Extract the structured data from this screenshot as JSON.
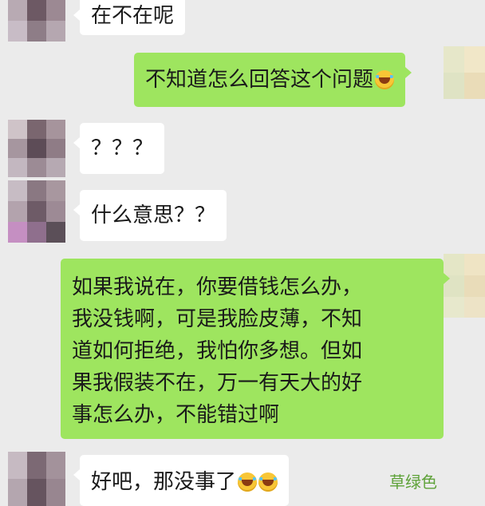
{
  "messages": [
    {
      "side": "left",
      "lines": [
        "在不在呢"
      ]
    },
    {
      "side": "right",
      "lines": [
        "不知道怎么回答这个问题"
      ],
      "emoji": [
        "face-with-tears-of-joy-icon"
      ]
    },
    {
      "side": "left",
      "lines": [
        "？？？"
      ]
    },
    {
      "side": "left",
      "lines": [
        "什么意思？？"
      ]
    },
    {
      "side": "right",
      "lines": [
        "如果我说在，你要借钱怎么办，",
        "我没钱啊，可是我脸皮薄，不知",
        "道如何拒绝，我怕你多想。但如",
        "果我假装不在，万一有天大的好",
        "事怎么办，不能错过啊"
      ]
    },
    {
      "side": "left",
      "lines": [
        "好吧，那没事了"
      ],
      "emoji": [
        "face-with-tears-of-joy-icon",
        "face-with-tears-of-joy-icon"
      ]
    }
  ],
  "watermark": "草绿色",
  "colors": {
    "background": "#ebebeb",
    "sent_bubble": "#9ee55f",
    "received_bubble": "#ffffff"
  }
}
